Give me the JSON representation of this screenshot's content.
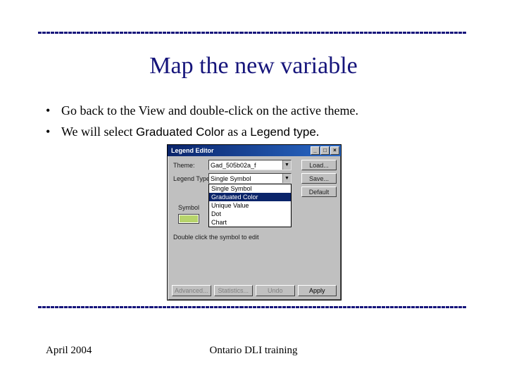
{
  "title": "Map the new variable",
  "bullets": {
    "b1": "Go back to the View and double-click on the active theme.",
    "b2_pre": "We will select ",
    "b2_mid": "Graduated Color",
    "b2_mid2": " as a ",
    "b2_end": "Legend type",
    "b2_period": "."
  },
  "dialog": {
    "title": "Legend Editor",
    "theme_label": "Theme:",
    "theme_value": "Gad_505b02a_f",
    "legend_type_label": "Legend Type:",
    "legend_type_value": "Single Symbol",
    "options": {
      "o0": "Single Symbol",
      "o1": "Graduated Color",
      "o2": "Unique Value",
      "o3": "Dot",
      "o4": "Chart"
    },
    "symbol_label": "Symbol",
    "dblclick_text": "Double click the symbol to edit",
    "buttons": {
      "load": "Load...",
      "save": "Save...",
      "default": "Default",
      "advanced": "Advanced...",
      "statistics": "Statistics...",
      "undo": "Undo",
      "apply": "Apply"
    }
  },
  "footer": {
    "date": "April 2004",
    "center": "Ontario DLI training"
  }
}
